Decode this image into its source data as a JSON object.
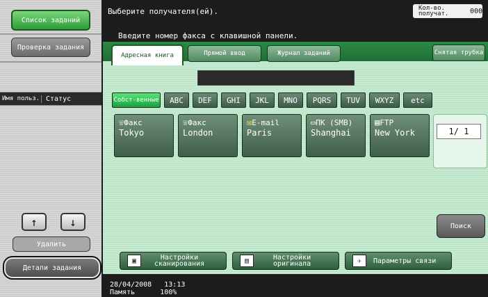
{
  "sidebar": {
    "job_list_label": "Список заданий",
    "job_check_label": "Проверка задания",
    "col_user": "Имя польз.",
    "col_status": "Статус",
    "arrow_up": "↑",
    "arrow_down": "↓",
    "delete_label": "Удалить",
    "job_details_label": "Детали задания"
  },
  "header": {
    "title": "Выберите получателя(ей).",
    "instruction": "Введите номер факса с клавишной панели.",
    "counter_label": "Кол-во. получат.",
    "counter_value": "000"
  },
  "tabs": {
    "address_book": "Адресная книга",
    "direct_input": "Прямой ввод",
    "job_log": "Журнал заданий",
    "hook": "Снятая трубка"
  },
  "index_tabs": [
    "Собст-венные",
    "ABC",
    "DEF",
    "GHI",
    "JKL",
    "MNO",
    "PQRS",
    "TUV",
    "WXYZ",
    "etc"
  ],
  "destinations": [
    {
      "type": "Факс",
      "name": "Tokyo",
      "icon": "fax-icon"
    },
    {
      "type": "Факс",
      "name": "London",
      "icon": "fax-icon"
    },
    {
      "type": "E-mail",
      "name": "Paris",
      "icon": "email-icon"
    },
    {
      "type": "ПК (SMB)",
      "name": "Shanghai",
      "icon": "pc-icon"
    },
    {
      "type": "FTP",
      "name": "New York",
      "icon": "ftp-icon"
    }
  ],
  "page_indicator": "1/ 1",
  "search_label": "Поиск",
  "bottom_buttons": {
    "scan_settings": "Настройки сканирования",
    "original_settings": "Настройки оригинала",
    "comm_settings": "Параметры связи"
  },
  "footer": {
    "datetime": "28/04/2008   13:13",
    "memory": "Память      100%"
  }
}
